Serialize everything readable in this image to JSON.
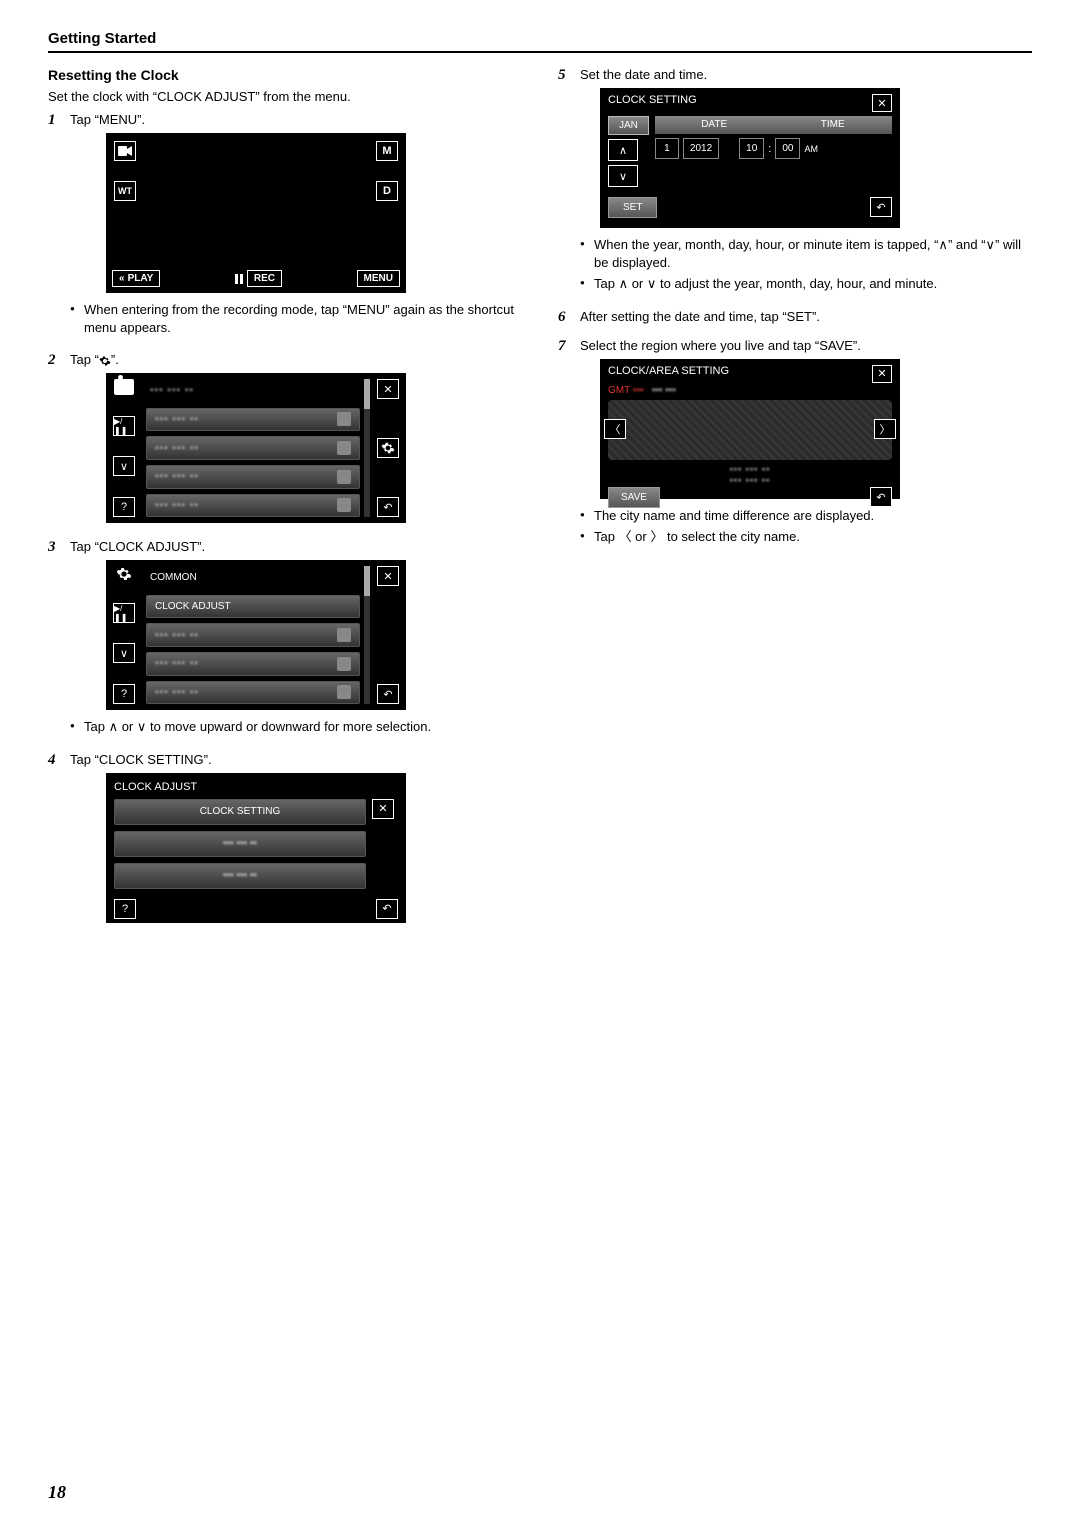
{
  "header": "Getting Started",
  "subhead": "Resetting the Clock",
  "intro": "Set the clock with “CLOCK ADJUST” from the menu.",
  "page_number": "18",
  "steps": {
    "1": {
      "text": "Tap “MENU”.",
      "screen": {
        "tl_label": " ",
        "tr_label": "M",
        "ml_label": "WT",
        "mr_label": "D",
        "play": "PLAY",
        "rec": "REC",
        "menu": "MENU"
      },
      "note": "When entering from the recording mode, tap “MENU” again as the shortcut menu appears."
    },
    "2": {
      "text_pre": "Tap “",
      "text_post": "”.",
      "screen_gear_name": "gear-icon"
    },
    "3": {
      "text": "Tap “CLOCK ADJUST”.",
      "screen": {
        "title": "COMMON",
        "item1": "CLOCK ADJUST"
      },
      "note": "Tap ∧ or ∨ to move upward or downward for more selection."
    },
    "4": {
      "text": "Tap “CLOCK SETTING”.",
      "screen": {
        "title": "CLOCK ADJUST",
        "item1": "CLOCK SETTING"
      }
    },
    "5": {
      "text": "Set the date and time.",
      "screen": {
        "title": "CLOCK SETTING",
        "month_tab": "JAN",
        "date_label": "DATE",
        "time_label": "TIME",
        "day": "1",
        "year": "2012",
        "hour": "10",
        "colon": ":",
        "min": "00",
        "ampm": "AM",
        "set": "SET"
      },
      "note1": "When the year, month, day, hour, or minute item is tapped, “∧” and “∨” will be displayed.",
      "note2": "Tap ∧ or ∨ to adjust the year, month, day, hour, and minute."
    },
    "6": {
      "text": "After setting the date and time, tap “SET”."
    },
    "7": {
      "text": "Select the region where you live and tap “SAVE”.",
      "screen": {
        "title": "CLOCK/AREA SETTING",
        "gmt": "GMT",
        "save": "SAVE"
      },
      "note1": "The city name and time difference are displayed.",
      "note2": "Tap 〈 or 〉 to select the city name."
    }
  }
}
